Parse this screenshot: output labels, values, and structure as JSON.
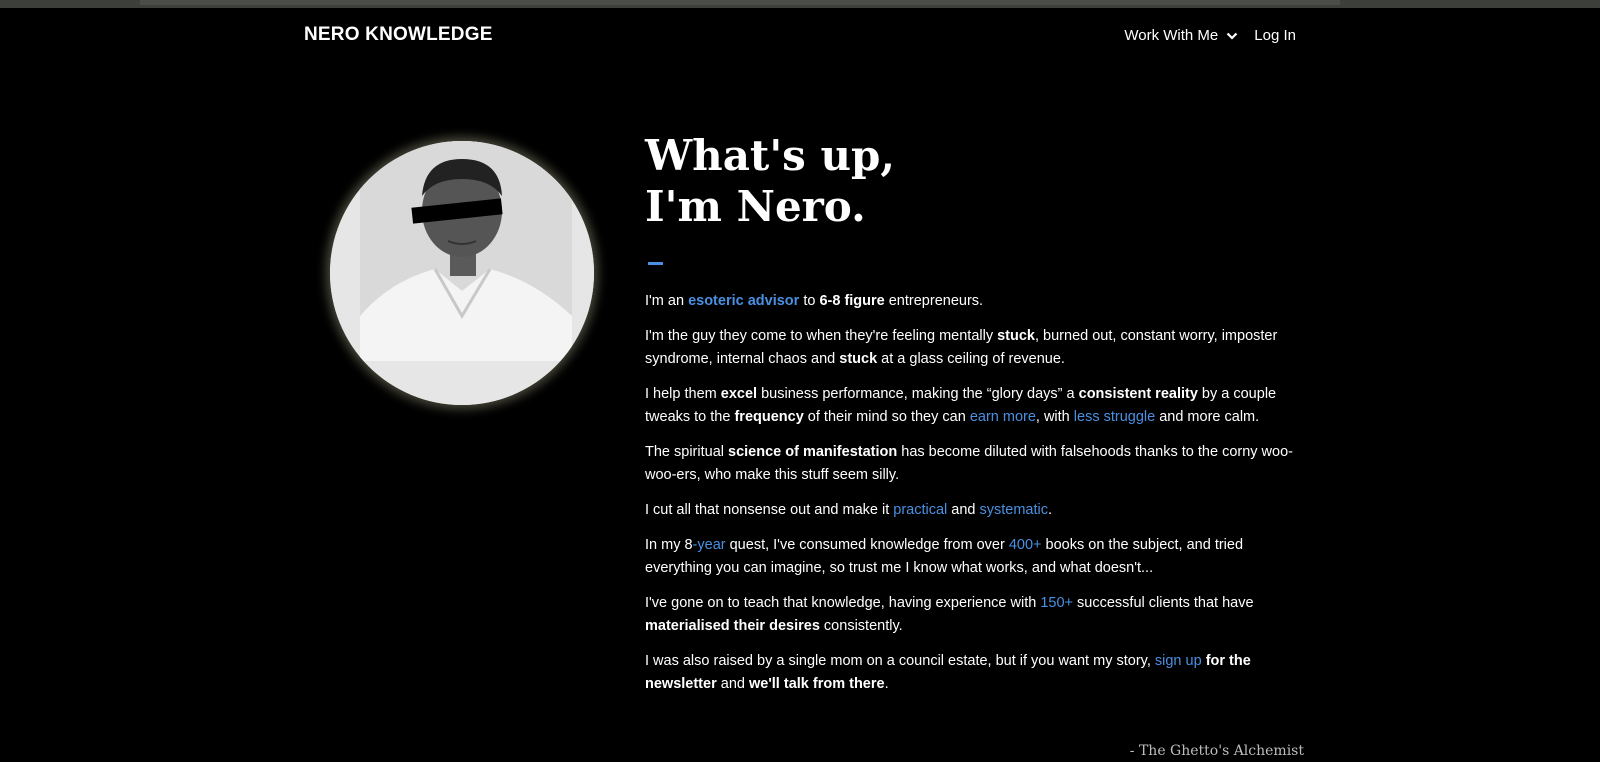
{
  "header": {
    "brand": "NERO KNOWLEDGE",
    "nav": {
      "work_with_me": "Work With Me",
      "chevron_icon": "chevron-down-icon",
      "log_in": "Log In"
    }
  },
  "hero": {
    "title_line1": "What's up,",
    "title_line2": "I'm Nero.",
    "accent_color": "#4a90e2"
  },
  "paragraphs": {
    "p1": {
      "a": "I'm an ",
      "b": "esoteric advisor",
      "c": " to ",
      "d": "6-8 figure",
      "e": " entrepreneurs."
    },
    "p2": {
      "a": "I'm the guy they come to when they're feeling mentally ",
      "b": "stuck",
      "c": ", burned out, constant worry, imposter syndrome, internal chaos and ",
      "d": "stuck",
      "e": " at a glass ceiling of revenue."
    },
    "p3": {
      "a": "I help them ",
      "b": "excel",
      "c": " business performance, making the “glory days” a ",
      "d": "consistent reality",
      "e": " by a couple tweaks to the ",
      "f": "frequency",
      "g": " of their mind so they can ",
      "h": "earn more",
      "i": ", with ",
      "j": "less struggle",
      "k": " and more calm."
    },
    "p4": {
      "a": "The spiritual ",
      "b": "science of manifestation",
      "c": " has become diluted with falsehoods thanks to the corny woo-woo-ers, who make this stuff seem silly."
    },
    "p5": {
      "a": "I cut all that nonsense out and make it ",
      "b": "practical",
      "c": " and ",
      "d": "systematic",
      "e": "."
    },
    "p6": {
      "a": "In my 8",
      "b": "-year",
      "c": " quest, I've consumed knowledge from over ",
      "d": "400+",
      "e": " books on the subject, and tried everything you can imagine, so trust me I know what works, and what doesn't..."
    },
    "p7": {
      "a": "I've gone on to teach that knowledge, having experience with ",
      "b": "150+",
      "c": " successful clients that have ",
      "d": "materialised their desires",
      "e": " consistently."
    },
    "p8": {
      "a": "I was also raised by a single mom on a council estate, but if you want my story, ",
      "b": "sign up",
      "c": " ",
      "d": "for the newsletter",
      "e": " and ",
      "f": "we'll talk from there",
      "g": "."
    }
  },
  "signature": "- The Ghetto's Alchemist"
}
